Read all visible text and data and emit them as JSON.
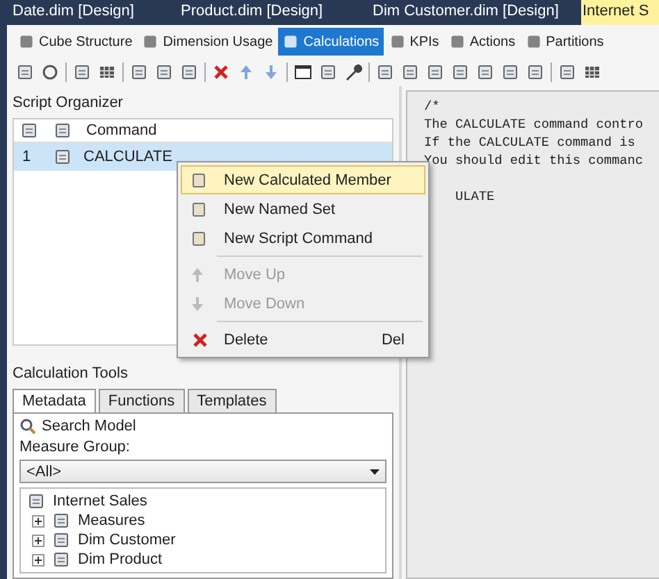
{
  "document_tabs": [
    {
      "label": "Date.dim [Design]",
      "selected": false
    },
    {
      "label": "Product.dim [Design]",
      "selected": false
    },
    {
      "label": "Dim Customer.dim [Design]",
      "selected": false
    },
    {
      "label": "Internet S",
      "selected": true
    }
  ],
  "designer_tabs": [
    {
      "label": "Cube Structure",
      "selected": false
    },
    {
      "label": "Dimension Usage",
      "selected": false
    },
    {
      "label": "Calculations",
      "selected": true
    },
    {
      "label": "KPIs",
      "selected": false
    },
    {
      "label": "Actions",
      "selected": false
    },
    {
      "label": "Partitions",
      "selected": false
    }
  ],
  "script_organizer": {
    "title": "Script Organizer",
    "column": "Command",
    "rows": [
      {
        "number": "1",
        "command": "CALCULATE",
        "selected": true
      }
    ]
  },
  "editor": {
    "lines": [
      {
        "kind": "line",
        "text": "/*"
      },
      {
        "kind": "line",
        "text": "The CALCULATE command contro"
      },
      {
        "kind": "line",
        "text": "If the CALCULATE command is"
      },
      {
        "kind": "line",
        "text": "You should edit this commanc"
      },
      {
        "kind": "covered",
        "text": "ULATE"
      }
    ]
  },
  "context_menu": {
    "items": [
      {
        "kind": "item",
        "label": "New Calculated Member",
        "selected": true,
        "disabled": false
      },
      {
        "kind": "item",
        "label": "New Named Set",
        "selected": false,
        "disabled": false
      },
      {
        "kind": "item",
        "label": "New Script Command",
        "selected": false,
        "disabled": false
      },
      {
        "kind": "separator"
      },
      {
        "kind": "item",
        "label": "Move Up",
        "selected": false,
        "disabled": true
      },
      {
        "kind": "item",
        "label": "Move Down",
        "selected": false,
        "disabled": true
      },
      {
        "kind": "separator"
      },
      {
        "kind": "item",
        "label": "Delete",
        "shortcut": "Del",
        "selected": false,
        "disabled": false
      }
    ]
  },
  "calculation_tools": {
    "title": "Calculation Tools",
    "tabs": [
      {
        "label": "Metadata",
        "selected": true
      },
      {
        "label": "Functions",
        "selected": false
      },
      {
        "label": "Templates",
        "selected": false
      }
    ],
    "search_label": "Search Model",
    "measure_group": {
      "label": "Measure Group:",
      "value": "<All>"
    },
    "tree": [
      {
        "label": "Internet Sales",
        "children": [
          {
            "label": "Measures",
            "expanded": false
          },
          {
            "label": "Dim Customer",
            "expanded": false
          },
          {
            "label": "Dim Product",
            "expanded": false
          }
        ]
      }
    ]
  }
}
